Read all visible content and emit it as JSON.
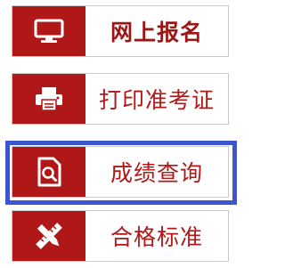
{
  "menu": {
    "items": [
      {
        "label": "网上报名",
        "icon": "monitor-icon",
        "active": true
      },
      {
        "label": "打印准考证",
        "icon": "printer-icon",
        "active": false
      },
      {
        "label": "成绩查询",
        "icon": "search-document-icon",
        "active": false
      },
      {
        "label": "合格标准",
        "icon": "ruler-pencil-icon",
        "active": false
      }
    ],
    "highlighted": "成绩查询"
  },
  "colors": {
    "accent": "#b01818",
    "highlight_frame": "#3d56d0",
    "border": "#c9c9c9"
  }
}
